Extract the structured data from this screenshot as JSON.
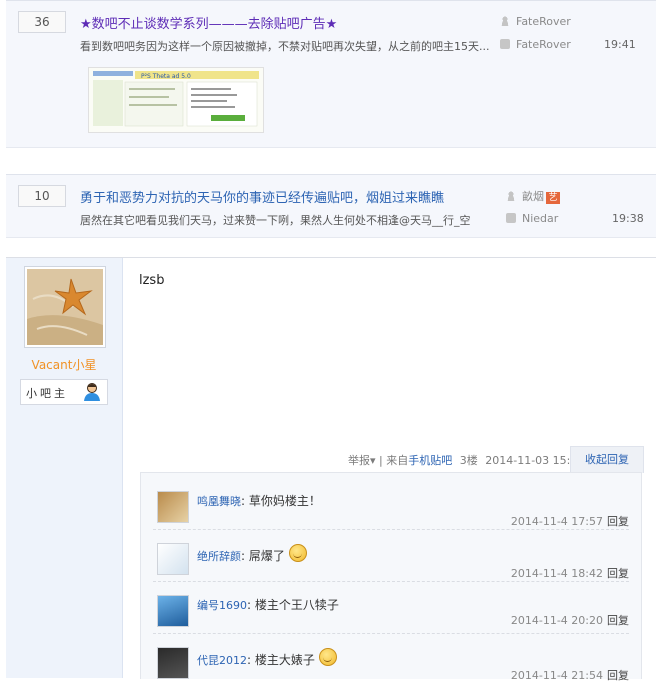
{
  "threads": [
    {
      "reply_count": "36",
      "title": "★数吧不止谈数学系列———去除贴吧广告★",
      "abstract": "看到数吧吧务因为这样一个原因被撤掉，不禁对贴吧再次失望，从之前的吧主15天...",
      "author": "FateRover",
      "last_replier": "FateRover",
      "time": "19:41",
      "thumb_caption": "P²S Theta ad 5.0"
    },
    {
      "reply_count": "10",
      "title": "勇于和恶势力对抗的天马你的事迹已经传遍贴吧，烟姐过来瞧瞧",
      "abstract": "居然在其它吧看见我们天马，过来赞一下咧，果然人生何处不相逢@天马__行_空",
      "author": "畝烟",
      "author_badge": "艺",
      "last_replier": "Niedar",
      "time": "19:38"
    }
  ],
  "post": {
    "author_name": "Vacant小星",
    "role": "小吧主",
    "content": "lzsb",
    "report_label": "举报",
    "source_prefix": "来自",
    "source_link": "手机贴吧",
    "floor": "3楼",
    "datetime": "2014-11-03 15:05",
    "fold_label": "收起回复",
    "replies": [
      {
        "name": "鸣凰舞晓",
        "text": "草你妈楼主！",
        "emoji": false,
        "date": "2014-11-4 17:57",
        "reply_label": "回复"
      },
      {
        "name": "绝所辞颜",
        "text": "屌爆了",
        "emoji": true,
        "date": "2014-11-4 18:42",
        "reply_label": "回复"
      },
      {
        "name": "编号1690",
        "text": "楼主个王八犊子",
        "emoji": false,
        "date": "2014-11-4 20:20",
        "reply_label": "回复"
      },
      {
        "name": "代昆2012",
        "text": "楼主大婊子",
        "emoji": true,
        "date": "2014-11-4 21:54",
        "reply_label": "回复"
      }
    ]
  },
  "colors": {
    "accent_blue": "#2d64b3",
    "title_purple": "#5d2cb6",
    "username_orange": "#f09227"
  }
}
